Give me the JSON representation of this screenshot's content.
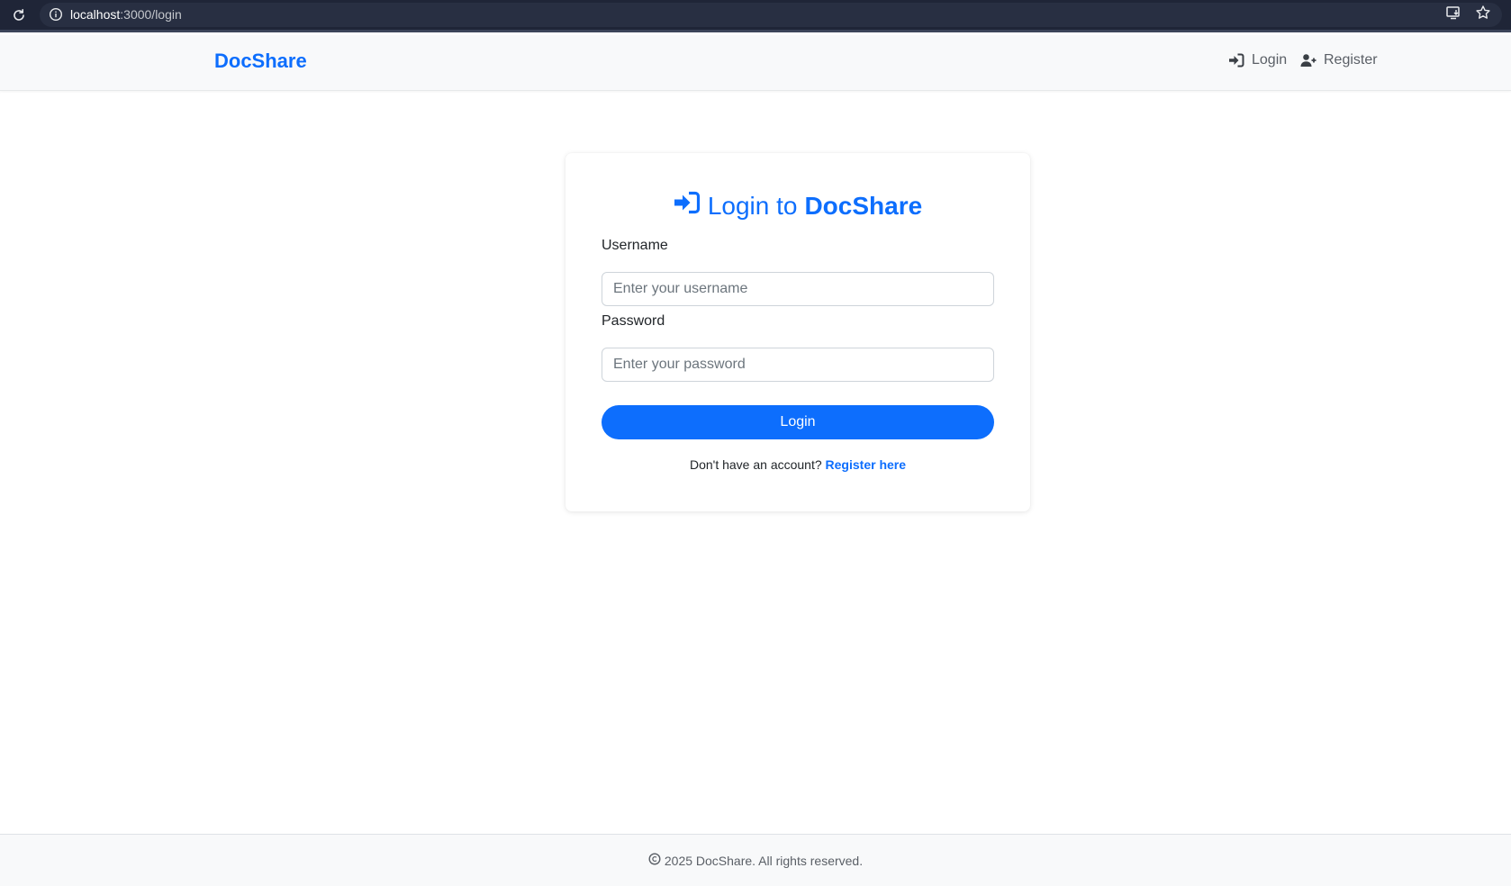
{
  "browser": {
    "url_host": "localhost",
    "url_path": ":3000/login"
  },
  "navbar": {
    "brand": "DocShare",
    "links": [
      {
        "label": "Login",
        "icon": "sign-in-icon"
      },
      {
        "label": "Register",
        "icon": "user-plus-icon"
      }
    ]
  },
  "login_card": {
    "title_prefix": "Login to",
    "title_brand": "DocShare",
    "username_label": "Username",
    "username_placeholder": "Enter your username",
    "password_label": "Password",
    "password_placeholder": "Enter your password",
    "submit_label": "Login",
    "register_prompt": "Don't have an account?",
    "register_link": "Register here"
  },
  "footer": {
    "text": "2025 DocShare. All rights reserved."
  },
  "colors": {
    "primary": "#0d6efd",
    "navbar_bg": "#f8f9fa",
    "browser_bar": "#1f2537"
  }
}
